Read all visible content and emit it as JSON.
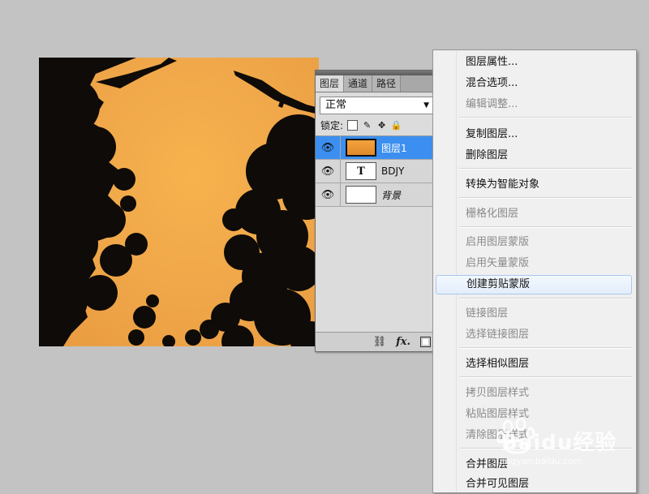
{
  "canvas": {
    "sky_color": "#f0a84a",
    "content": "tree-silhouette"
  },
  "layers_panel": {
    "tabs": [
      {
        "label": "图层",
        "active": true
      },
      {
        "label": "通道",
        "active": false
      },
      {
        "label": "路径",
        "active": false
      }
    ],
    "blend_mode": "正常",
    "lock_label": "锁定:",
    "layers": [
      {
        "name": "图层1",
        "thumb": "photo",
        "visible": true,
        "selected": true
      },
      {
        "name": "BDJY",
        "thumb": "T",
        "visible": true,
        "selected": false
      },
      {
        "name": "背景",
        "thumb": "white",
        "visible": true,
        "selected": false
      }
    ],
    "footer_icons": [
      "link-icon",
      "fx-icon",
      "mask-icon"
    ],
    "selection_color": "#3c8ff0"
  },
  "context_menu": {
    "items": [
      {
        "label": "图层属性...",
        "enabled": true
      },
      {
        "label": "混合选项...",
        "enabled": true
      },
      {
        "label": "编辑调整...",
        "enabled": false
      },
      {
        "label": "复制图层...",
        "enabled": true
      },
      {
        "label": "删除图层",
        "enabled": true
      },
      {
        "label": "转换为智能对象",
        "enabled": true
      },
      {
        "label": "栅格化图层",
        "enabled": false
      },
      {
        "label": "启用图层蒙版",
        "enabled": false
      },
      {
        "label": "启用矢量蒙版",
        "enabled": false
      },
      {
        "label": "创建剪贴蒙版",
        "enabled": true,
        "hover": true
      },
      {
        "label": "链接图层",
        "enabled": false
      },
      {
        "label": "选择链接图层",
        "enabled": false
      },
      {
        "label": "选择相似图层",
        "enabled": true
      },
      {
        "label": "拷贝图层样式",
        "enabled": false
      },
      {
        "label": "粘贴图层样式",
        "enabled": false
      },
      {
        "label": "清除图层样式",
        "enabled": false
      },
      {
        "label": "合并图层",
        "enabled": true
      },
      {
        "label": "合并可见图层",
        "enabled": true
      }
    ]
  },
  "watermark": {
    "text": "Baidu经验",
    "url": "jingyan.baidu.com"
  }
}
